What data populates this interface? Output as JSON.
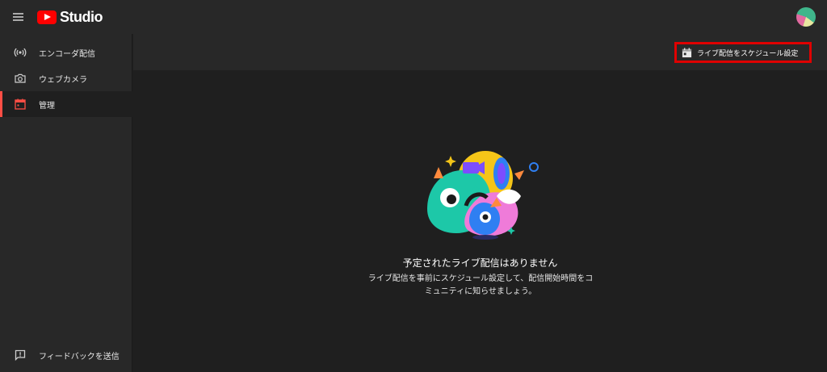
{
  "app": {
    "logo_text": "Studio"
  },
  "colors": {
    "brand_red": "#ff0000",
    "active_accent": "#ff4e45",
    "highlight_box": "#e00000"
  },
  "sidebar": {
    "items": [
      {
        "label": "エンコーダ配信",
        "icon": "broadcast-icon"
      },
      {
        "label": "ウェブカメラ",
        "icon": "camera-icon"
      },
      {
        "label": "管理",
        "icon": "calendar-icon",
        "active": true
      }
    ],
    "feedback": {
      "label": "フィードバックを送信",
      "icon": "feedback-icon"
    }
  },
  "toolbar": {
    "schedule_label": "ライブ配信をスケジュール設定",
    "schedule_icon": "calendar-add-icon"
  },
  "empty_state": {
    "title": "予定されたライブ配信はありません",
    "description": "ライブ配信を事前にスケジュール設定して、配信開始時間をコミュニティに知らせましょう。"
  }
}
